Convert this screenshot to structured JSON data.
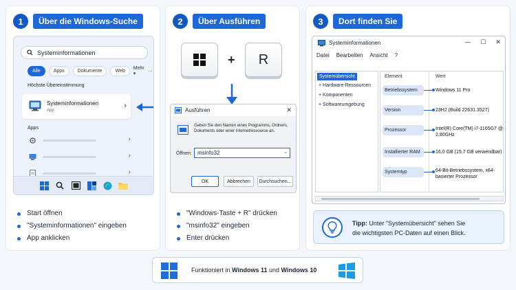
{
  "steps": [
    {
      "num": "1",
      "title": "Über die Windows-Suche"
    },
    {
      "num": "2",
      "title": "Über Ausführen"
    },
    {
      "num": "3",
      "title": "Dort finden Sie"
    }
  ],
  "start_menu": {
    "search_value": "Systeminformationen",
    "filters": [
      "Alle",
      "Apps",
      "Dokumente",
      "Web",
      "Mehr"
    ],
    "best_match_label": "Höchste Übereinstimmung",
    "best_match_name": "Systeminformationen",
    "best_match_type": "App",
    "apps_label": "Apps"
  },
  "panel1_bullets": [
    "Start öffnen",
    "\"Systeminformationen\" eingeben",
    "App anklicken"
  ],
  "keys": {
    "key1_icon": "windows-logo",
    "plus": "+",
    "key2": "R"
  },
  "run_dialog": {
    "title": "Ausführen",
    "description": "Geben Sie den Namen eines Programms, Ordners, Dokuments oder einer Internetressource an.",
    "open_label": "Öffnen:",
    "input_value": "msinfo32",
    "buttons": [
      "OK",
      "Abbrechen",
      "Durchsuchen..."
    ]
  },
  "panel2_bullets": [
    "\"Windows-Taste + R\" drücken",
    "\"msinfo32\" eingeben",
    "Enter drücken"
  ],
  "sysinfo": {
    "title": "Systeminformationen",
    "menu": [
      "Datei",
      "Bearbeiten",
      "Ansicht",
      "?"
    ],
    "tree_selected": "Systemübersicht",
    "tree_nodes": [
      "Hardware-Ressourcen",
      "Komponenten",
      "Softwareumgebung"
    ],
    "col_element": "Element",
    "col_value": "Wert",
    "rows": [
      {
        "element": "Betriebssystem",
        "value": "Windows 11 Pro"
      },
      {
        "element": "Version",
        "value": "23H2 (Build 22631.3527)"
      },
      {
        "element": "Prozessor",
        "value": "Intel(R) Core(TM) i7-1165G7 @ 2.80GHz"
      },
      {
        "element": "Installierter RAM",
        "value": "16,0 GB (15,7 GB verwendbar)"
      },
      {
        "element": "Systemtyp",
        "value": "64-Bit-Betriebssystem, x64-basierter Prozessor"
      }
    ]
  },
  "tip": {
    "bold": "Tipp:",
    "line1": "Unter \"Systemübersicht\" sehen Sie",
    "line2": "die wichtigsten PC-Daten auf einen Blick."
  },
  "footer": {
    "prefix": "Funktioniert in ",
    "win11": "Windows 11",
    "mid": " und ",
    "win10": "Windows 10"
  },
  "colors": {
    "accent": "#1e67d6",
    "accent_dark": "#1259c3",
    "background": "#f3f6fb"
  }
}
